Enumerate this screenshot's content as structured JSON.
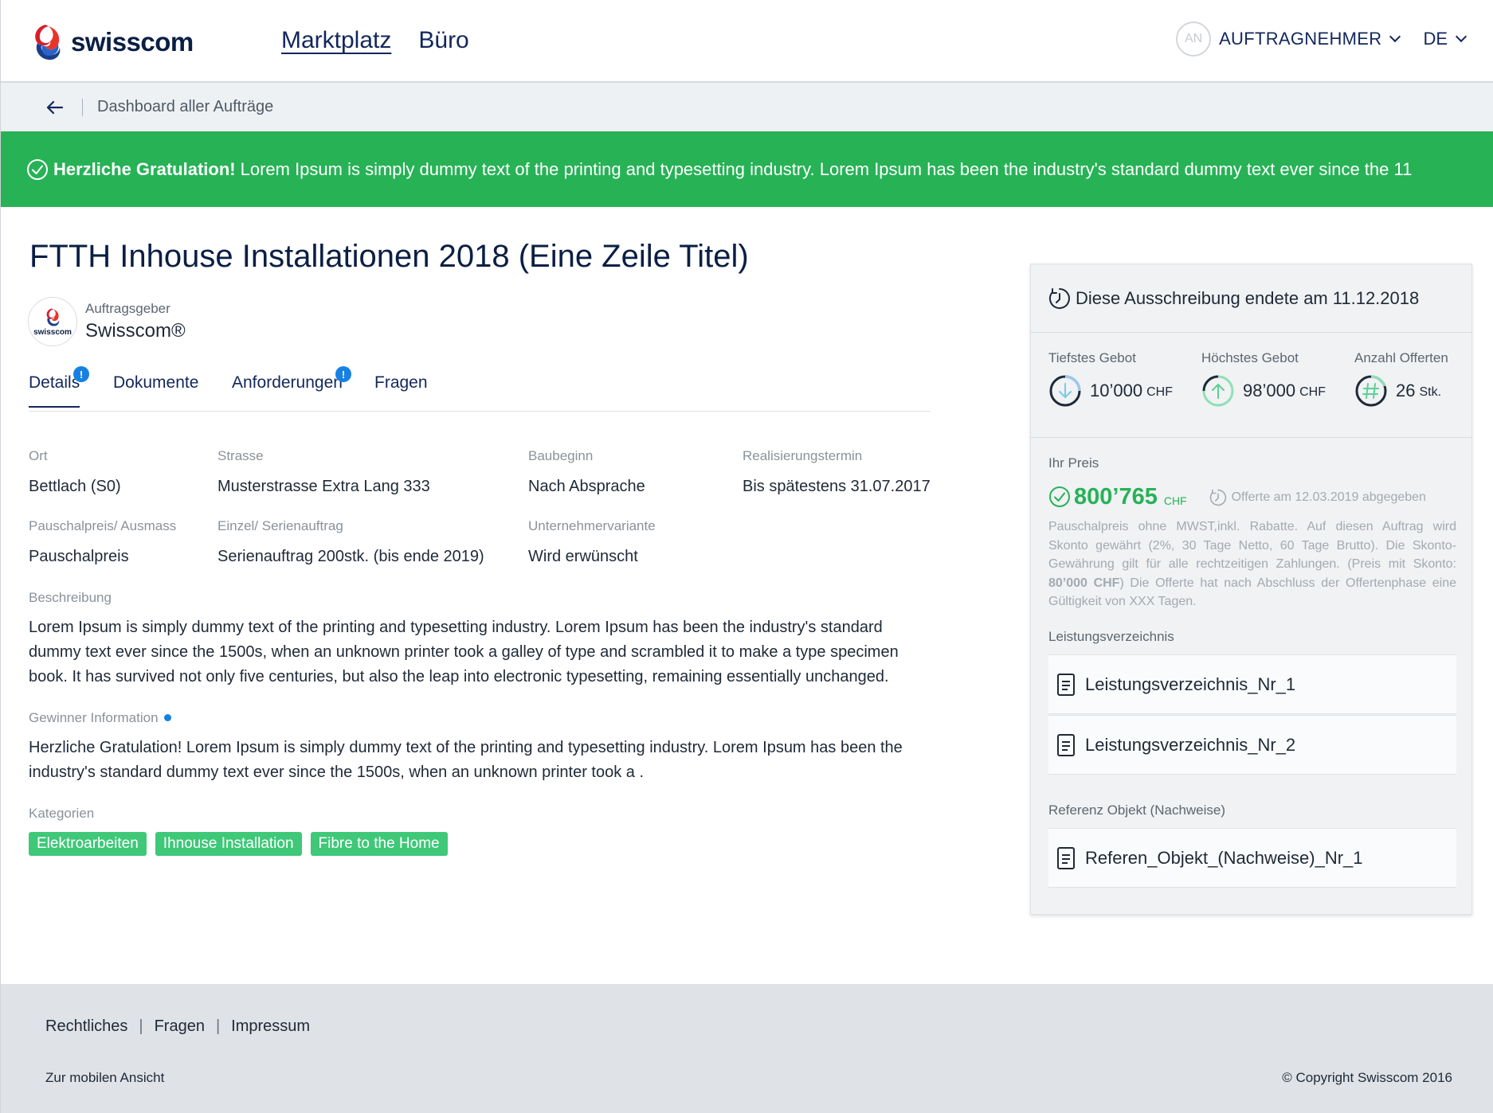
{
  "header": {
    "brand": "swisscom",
    "nav": [
      {
        "label": "Marktplatz",
        "active": true
      },
      {
        "label": "Büro",
        "active": false
      }
    ],
    "avatar_initials": "AN",
    "role_label": "AUFTRAGNEHMER",
    "language": "DE"
  },
  "breadcrumb": {
    "label": "Dashboard aller Aufträge"
  },
  "banner": {
    "bold": "Herzliche Gratulation!",
    "text": "Lorem Ipsum is simply dummy text of the printing and typesetting industry. Lorem Ipsum has been the industry's standard dummy text ever since the 11",
    "color": "#27b256"
  },
  "project": {
    "title": "FTTH Inhouse Installationen 2018 (Eine Zeile Titel)",
    "client_label": "Auftragsgeber",
    "client_name": "Swisscom®",
    "client_logo_text": "swisscom"
  },
  "tabs": [
    {
      "label": "Details",
      "active": true,
      "badge": "!"
    },
    {
      "label": "Dokumente",
      "active": false,
      "badge": ""
    },
    {
      "label": "Anforderungen",
      "active": false,
      "badge": "!"
    },
    {
      "label": "Fragen",
      "active": false,
      "badge": ""
    }
  ],
  "details": {
    "ort": {
      "label": "Ort",
      "value": "Bettlach (S0)"
    },
    "strasse": {
      "label": "Strasse",
      "value": "Musterstrasse Extra Lang 333"
    },
    "baubeginn": {
      "label": "Baubeginn",
      "value": "Nach Absprache"
    },
    "realisierung": {
      "label": "Realisierungstermin",
      "value": "Bis spätestens 31.07.2017"
    },
    "pauschal": {
      "label": "Pauschalpreis/ Ausmass",
      "value": "Pauschalpreis"
    },
    "serie": {
      "label": "Einzel/ Serienauftrag",
      "value": "Serienauftrag 200stk. (bis ende 2019)"
    },
    "variante": {
      "label": "Unternehmervariante",
      "value": "Wird erwünscht"
    }
  },
  "beschreibung": {
    "label": "Beschreibung",
    "text": "Lorem Ipsum is simply dummy text of the printing and typesetting industry. Lorem Ipsum has been the industry's standard dummy text ever since the 1500s, when an unknown printer took a galley of type and scrambled it to make a type specimen book. It has survived not only five centuries, but also the leap into electronic typesetting, remaining essentially unchanged."
  },
  "gewinner": {
    "label": "Gewinner Information",
    "text": "Herzliche Gratulation!  Lorem Ipsum is simply dummy text of the printing and typesetting industry. Lorem Ipsum has been the industry's standard dummy text ever since the 1500s, when an unknown printer took a ."
  },
  "kategorien": {
    "label": "Kategorien",
    "tags": [
      "Elektroarbeiten",
      "Ihnouse Installation",
      "Fibre to the Home"
    ]
  },
  "panel": {
    "end_text": "Diese Ausschreibung endete am",
    "end_date": "11.12.2018",
    "stats": [
      {
        "label": "Tiefstes Gebot",
        "value": "10’000",
        "unit": "CHF",
        "icon": "arrow-down-icon"
      },
      {
        "label": "Höchstes Gebot",
        "value": "98’000",
        "unit": "CHF",
        "icon": "arrow-up-icon"
      },
      {
        "label": "Anzahl Offerten",
        "value": "26",
        "unit": "Stk.",
        "icon": "hash-icon"
      }
    ],
    "price_label": "Ihr Preis",
    "price_value": "800’765",
    "price_unit": "CHF",
    "offer_note": "Offerte am 12.03.2019 abgegeben",
    "price_desc_1": "Pauschalpreis ohne MWST,inkl. Rabatte. Auf diesen Auftrag wird Skonto gewährt (2%, 30 Tage Netto, 60 Tage Brutto). Die Skonto-Gewährung gilt für alle rechtzeitigen Zahlungen. (Preis mit Skonto: ",
    "price_desc_bold": "80’000 CHF",
    "price_desc_2": ") Die Offerte hat nach Abschluss der Offertenphase eine Gültigkeit von XXX Tagen.",
    "lv_label": "Leistungsverzeichnis",
    "lv_docs": [
      "Leistungsverzeichnis_Nr_1",
      "Leistungsverzeichnis_Nr_2"
    ],
    "ref_label": "Referenz Objekt (Nachweise)",
    "ref_docs": [
      "Referen_Objekt_(Nachweise)_Nr_1"
    ]
  },
  "footer": {
    "links": [
      "Rechtliches",
      "Fragen",
      "Impressum"
    ],
    "separator": "|",
    "mobile": "Zur mobilen Ansicht",
    "copyright": "© Copyright Swisscom 2016"
  },
  "colors": {
    "brand_navy": "#12275b",
    "success": "#27b256",
    "tag": "#3ec878",
    "info": "#1781e3"
  }
}
